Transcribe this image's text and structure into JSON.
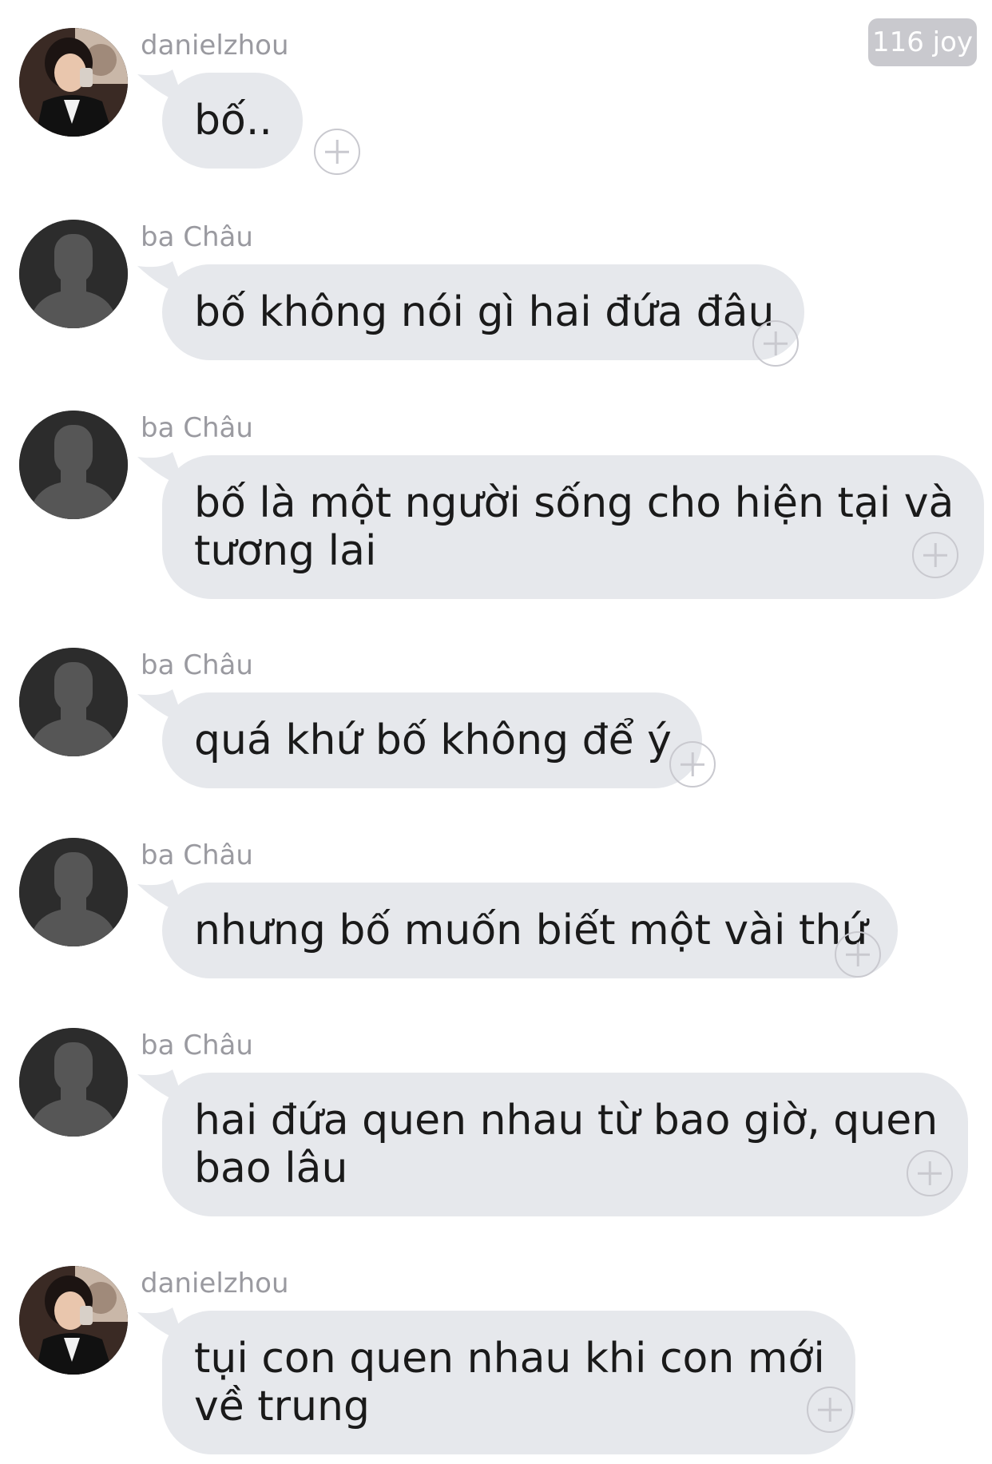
{
  "header": {
    "badge": "116 joy"
  },
  "messages": [
    {
      "sender": "danielzhou",
      "avatar": "user-photo-avatar",
      "text": "bố.."
    },
    {
      "sender": "ba Châu",
      "avatar": "default-person-avatar",
      "text": "bố không nói gì hai đứa đâu"
    },
    {
      "sender": "ba Châu",
      "avatar": "default-person-avatar",
      "text": "bố là một người sống cho hiện tại và\ntương lai"
    },
    {
      "sender": "ba Châu",
      "avatar": "default-person-avatar",
      "text": "quá khứ bố không để ý"
    },
    {
      "sender": "ba Châu",
      "avatar": "default-person-avatar",
      "text": "nhưng bố muốn biết một vài thứ"
    },
    {
      "sender": "ba Châu",
      "avatar": "default-person-avatar",
      "text": "hai đứa quen nhau từ bao giờ, quen\nbao lâu"
    },
    {
      "sender": "danielzhou",
      "avatar": "user-photo-avatar",
      "text": "tụi con quen nhau khi con mới\nvề trung"
    }
  ],
  "icons": {
    "add": "plus-circle-icon"
  },
  "colors": {
    "bubble": "#e6e8ec",
    "badge": "#c9c9ce",
    "sender": "#9a9aa0",
    "plus": "#c9c9cf"
  }
}
